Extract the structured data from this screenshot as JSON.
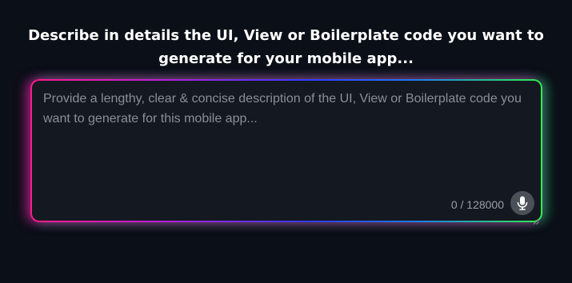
{
  "heading": {
    "line1": "Describe in details the UI, View or Boilerplate code you want to",
    "line2": "generate for your mobile app..."
  },
  "prompt": {
    "value": "",
    "placeholder": "Provide a lengthy, clear & concise description of the UI, View or Boilerplate code you want to generate for this mobile app...",
    "char_count": "0 / 128000"
  },
  "icons": {
    "mic": "microphone-icon",
    "resize": "resize-grip-icon"
  },
  "colors": {
    "background": "#0b0f17",
    "field_background": "#141821",
    "glow_left": "#ff1a8c",
    "glow_middle": "#2e3cff",
    "glow_right": "#2ef04a",
    "mic_button": "#4b4f57"
  }
}
